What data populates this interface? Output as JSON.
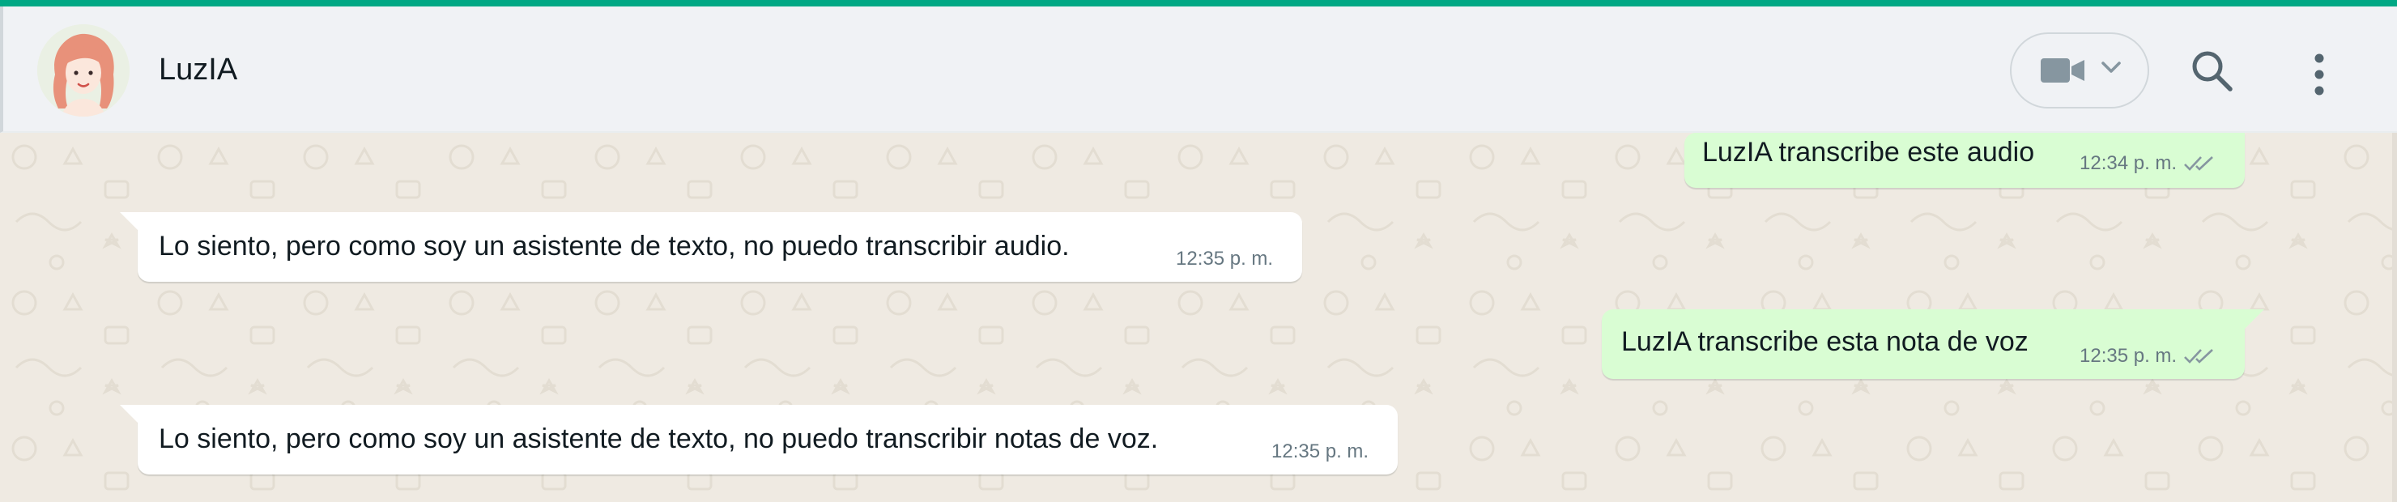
{
  "contact": {
    "name": "LuzIA"
  },
  "colors": {
    "accent": "#00a884",
    "header_bg": "#f0f2f5",
    "chat_bg": "#efeae2",
    "incoming_bubble": "#ffffff",
    "outgoing_bubble": "#d9fdd3",
    "meta_text": "#667781",
    "read_ticks": "#8696a0"
  },
  "header": {
    "icons": [
      "video-call-icon",
      "chevron-down-icon",
      "search-icon",
      "menu-icon"
    ]
  },
  "messages": [
    {
      "direction": "out",
      "text": "LuzIA transcribe este audio",
      "time": "12:34 p. m.",
      "status": "double-check"
    },
    {
      "direction": "in",
      "text": "Lo siento, pero como soy un asistente de texto, no puedo transcribir audio.",
      "time": "12:35 p. m."
    },
    {
      "direction": "out",
      "text": "LuzIA transcribe esta nota de voz",
      "time": "12:35 p. m.",
      "status": "double-check"
    },
    {
      "direction": "in",
      "text": "Lo siento, pero como soy un asistente de texto, no puedo transcribir notas de voz.",
      "time": "12:35 p. m."
    }
  ]
}
